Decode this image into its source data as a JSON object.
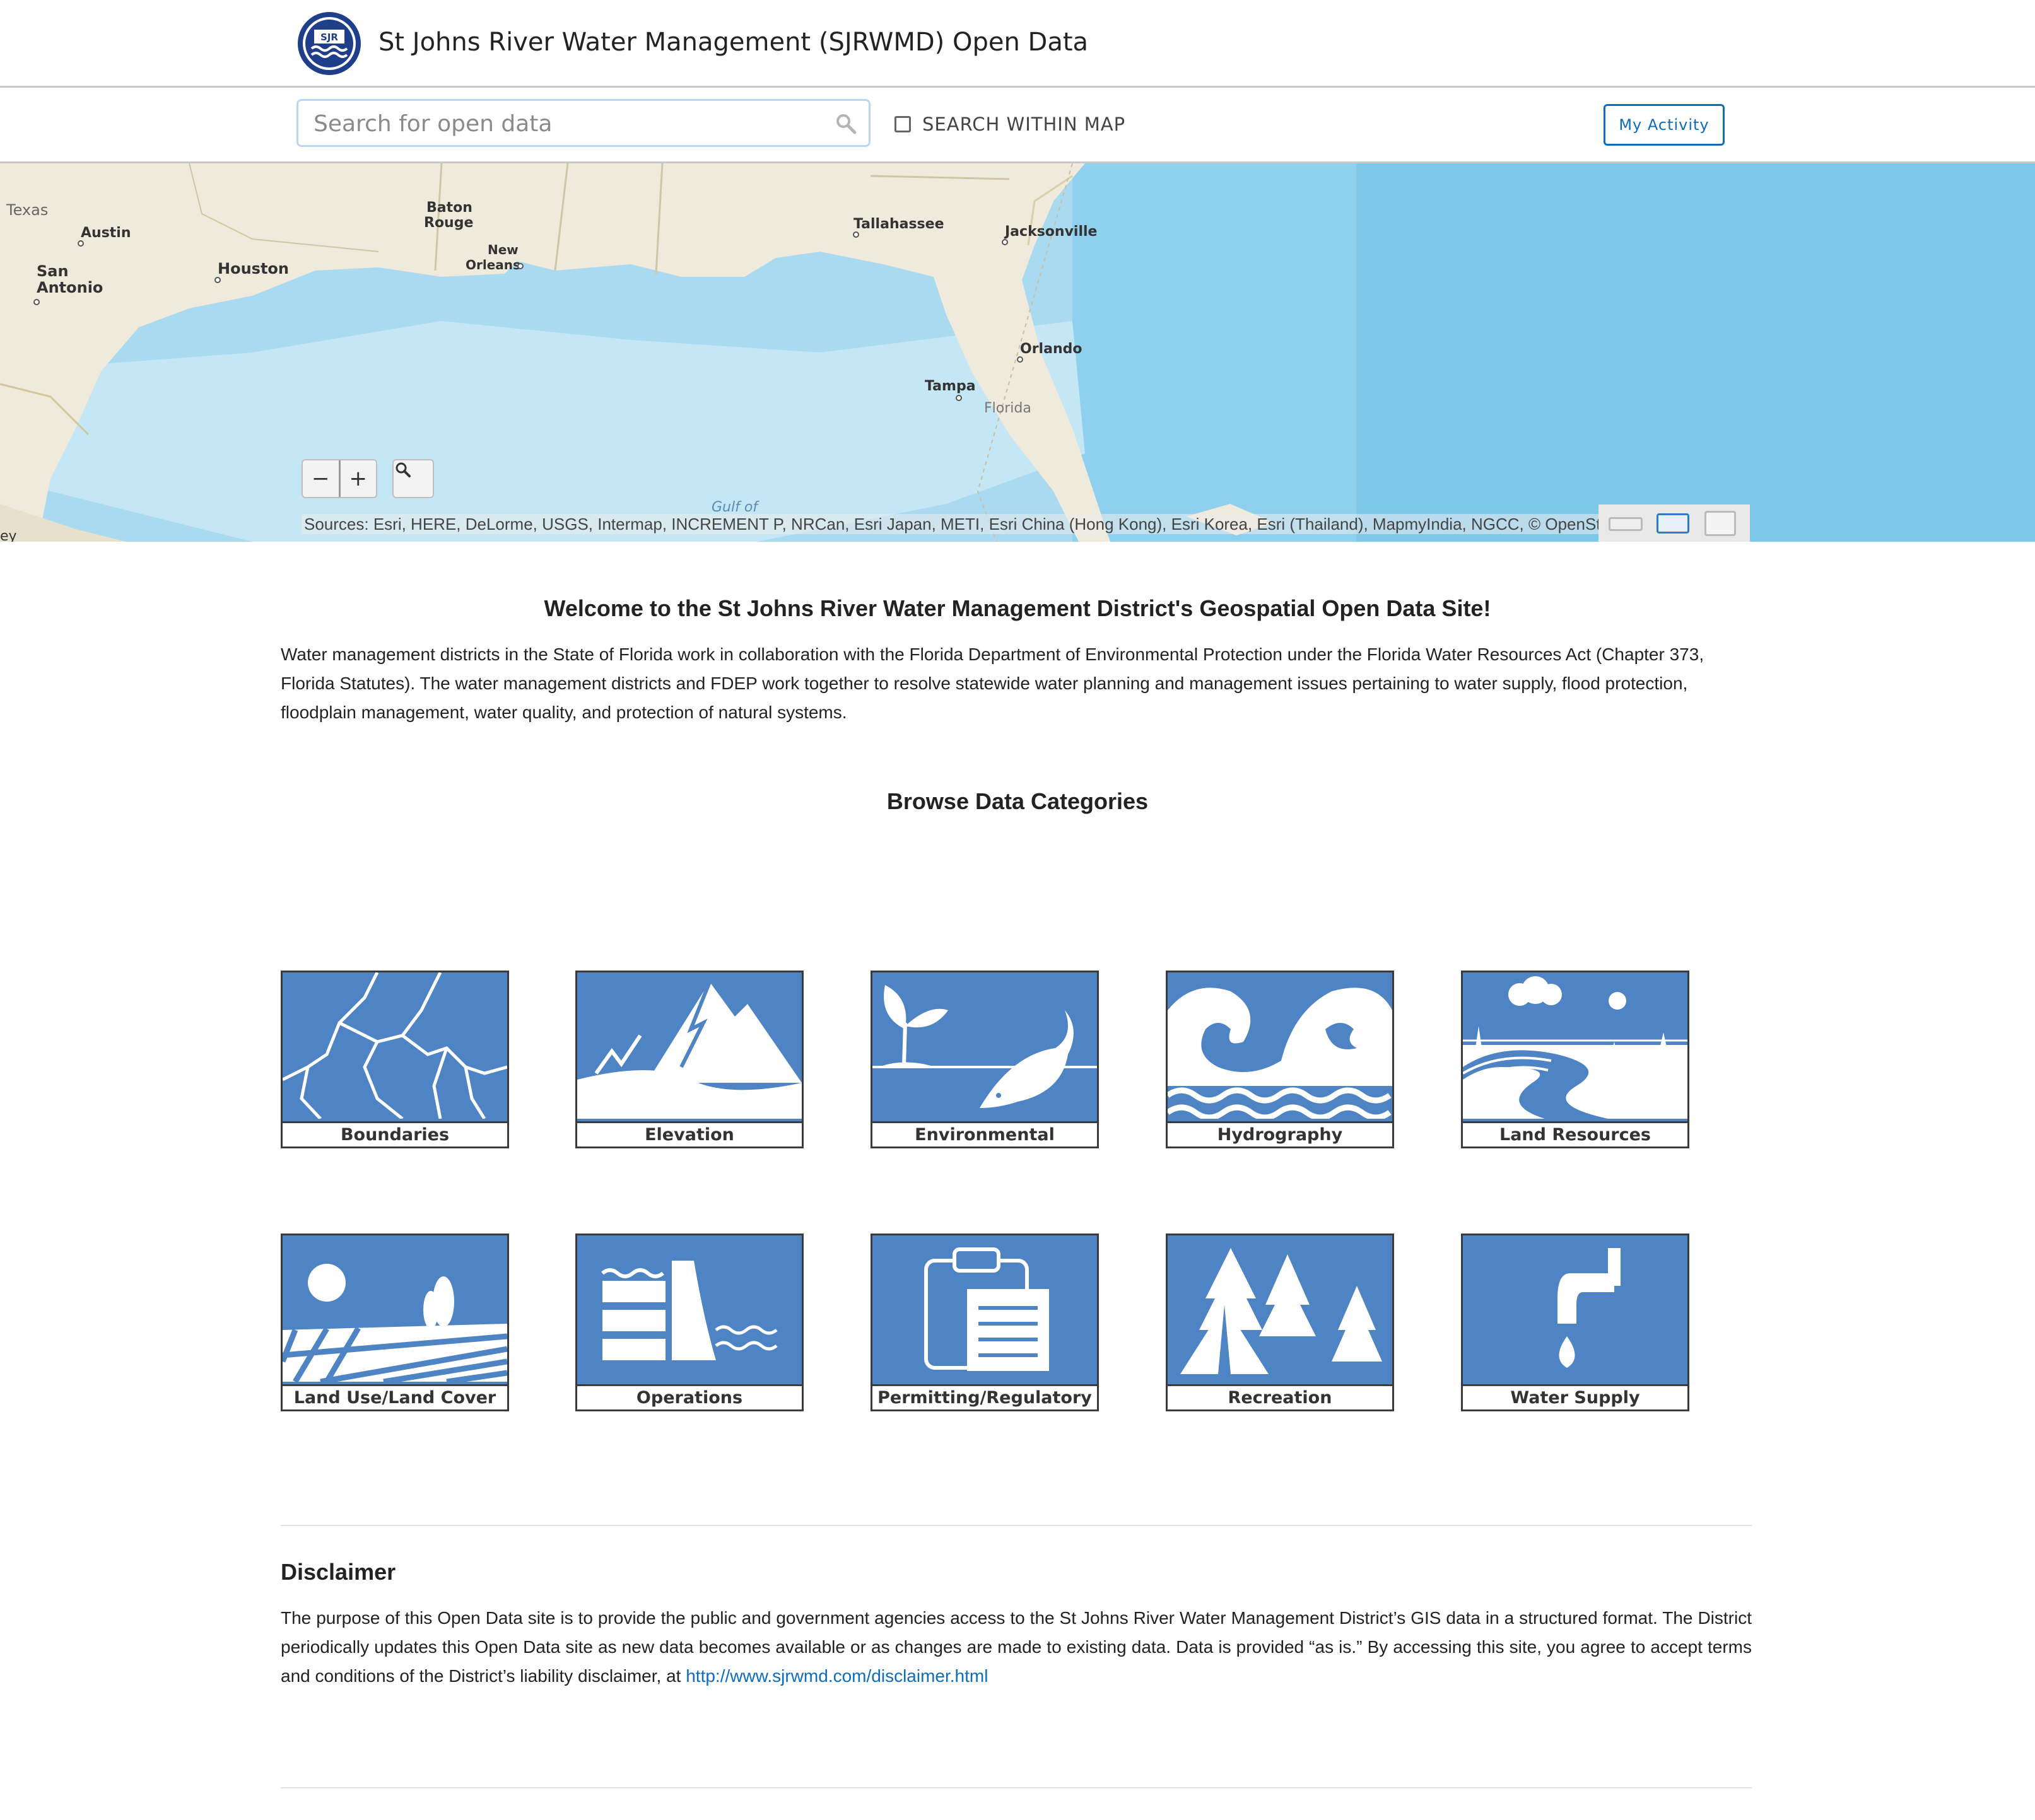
{
  "header": {
    "title": "St Johns River Water Management (SJRWMD) Open Data",
    "logo_text": "SJR"
  },
  "search": {
    "placeholder": "Search for open data",
    "within_map_label": "SEARCH WITHIN MAP",
    "my_activity_label": "My Activity"
  },
  "map": {
    "labels": [
      {
        "text": "Texas"
      },
      {
        "text": "Austin"
      },
      {
        "text": "San"
      },
      {
        "text": "Antonio"
      },
      {
        "text": "Houston"
      },
      {
        "text": "Baton"
      },
      {
        "text": "Rouge"
      },
      {
        "text": "New"
      },
      {
        "text": "Orleans"
      },
      {
        "text": "Tallahassee"
      },
      {
        "text": "Jacksonville"
      },
      {
        "text": "Orlando"
      },
      {
        "text": "Tampa"
      },
      {
        "text": "Florida"
      },
      {
        "text": "Gulf of"
      },
      {
        "text": "ey"
      }
    ],
    "zoom_out": "−",
    "zoom_in": "+",
    "attribution": "Sources: Esri, HERE, DeLorme, USGS, Intermap, INCREMENT P, NRCan, Esri Japan, METI, Esri China (Hong Kong), Esri Korea, Esri (Thailand), MapmyIndia, NGCC, © OpenStre"
  },
  "welcome": {
    "title": "Welcome to the St Johns River Water Management District's Geospatial Open Data Site!",
    "body": "Water management districts in the State of Florida work in collaboration with the Florida Department of Environmental Protection under the Florida Water Resources Act (Chapter 373, Florida Statutes). The water management districts and FDEP work together to resolve statewide water planning and management issues pertaining to water supply, flood protection, floodplain management, water quality, and protection of natural systems."
  },
  "browse": {
    "title": "Browse Data Categories",
    "categories": [
      {
        "label": "Boundaries"
      },
      {
        "label": "Elevation"
      },
      {
        "label": "Environmental"
      },
      {
        "label": "Hydrography"
      },
      {
        "label": "Land Resources"
      },
      {
        "label": "Land Use/Land Cover"
      },
      {
        "label": "Operations"
      },
      {
        "label": "Permitting/Regulatory"
      },
      {
        "label": "Recreation"
      },
      {
        "label": "Water Supply"
      }
    ]
  },
  "disclaimer": {
    "title": "Disclaimer",
    "body": "The purpose of this Open Data site is to provide the public and government agencies access to the St Johns River Water Management District’s GIS data in a structured format. The District periodically updates this Open Data site as new data becomes available or as changes are made to existing data. Data is provided “as is.” By accessing this site, you agree to accept terms and conditions of the District’s liability disclaimer, at ",
    "link": "http://www.sjrwmd.com/disclaimer.html"
  },
  "colors": {
    "tile_blue": "#4f84c4",
    "link_blue": "#0f6cbd",
    "water": "#b9e0f2",
    "land": "#efeadb"
  }
}
